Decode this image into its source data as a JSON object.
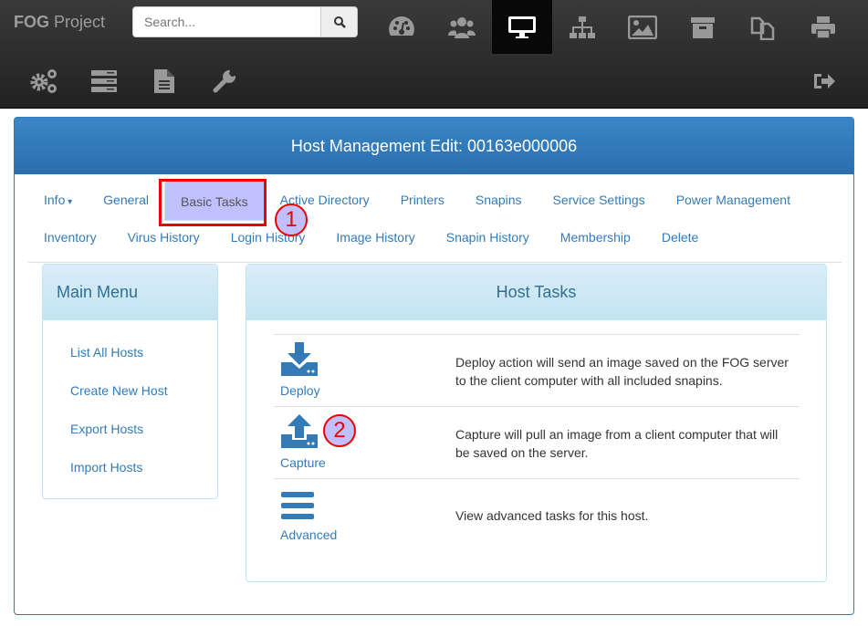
{
  "brand": {
    "bold": "FOG",
    "rest": " Project"
  },
  "search": {
    "placeholder": "Search..."
  },
  "nav_top": [
    {
      "icon": "dashboard-icon"
    },
    {
      "icon": "users-icon"
    },
    {
      "icon": "desktop-icon",
      "active": true
    },
    {
      "icon": "sitemap-icon"
    },
    {
      "icon": "image-icon"
    },
    {
      "icon": "archive-icon"
    },
    {
      "icon": "copy-icon"
    },
    {
      "icon": "print-icon"
    }
  ],
  "nav_bottom": [
    {
      "icon": "cogs-icon"
    },
    {
      "icon": "server-icon"
    },
    {
      "icon": "file-text-icon"
    },
    {
      "icon": "wrench-icon"
    }
  ],
  "logout_icon": "sign-out-icon",
  "header": {
    "title": "Host Management Edit: 00163e000006"
  },
  "tabs_row1": [
    "Info",
    "General",
    "Basic Tasks",
    "Active Directory",
    "Printers",
    "Snapins",
    "Service Settings",
    "Power Management"
  ],
  "tabs_row2": [
    "Inventory",
    "Virus History",
    "Login History",
    "Image History",
    "Snapin History",
    "Membership",
    "Delete"
  ],
  "active_tab": "Basic Tasks",
  "side": {
    "title": "Main Menu",
    "items": [
      "List All Hosts",
      "Create New Host",
      "Export Hosts",
      "Import Hosts"
    ]
  },
  "main": {
    "title": "Host Tasks",
    "tasks": [
      {
        "label": "Deploy",
        "icon": "download-icon",
        "desc": "Deploy action will send an image saved on the FOG server to the client computer with all included snapins."
      },
      {
        "label": "Capture",
        "icon": "upload-icon",
        "desc": "Capture will pull an image from a client computer that will be saved on the server."
      },
      {
        "label": "Advanced",
        "icon": "bars-icon",
        "desc": "View advanced tasks for this host."
      }
    ]
  },
  "annotations": [
    "1",
    "2"
  ],
  "colors": {
    "accent": "#337ab7",
    "highlight": "#c0c0ff",
    "annotation": "#ee0000"
  }
}
